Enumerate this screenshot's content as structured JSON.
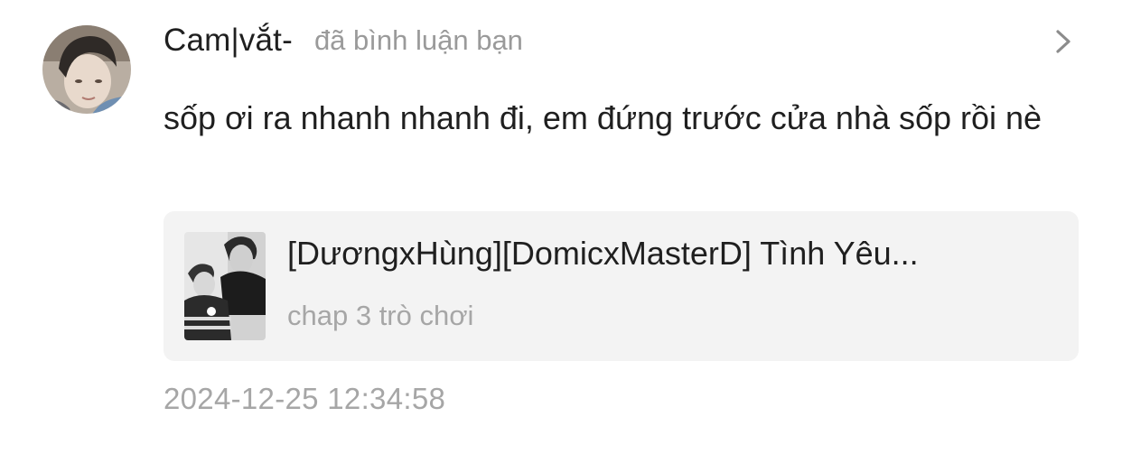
{
  "notification": {
    "username": "Cam|vắt-",
    "action": "đã bình luận bạn",
    "comment": "sốp ơi ra nhanh nhanh đi, em đứng trước cửa nhà sốp rồi nè",
    "timestamp": "2024-12-25 12:34:58",
    "avatar_icon": "user-avatar-photo",
    "chevron_icon": "chevron-right-icon"
  },
  "story": {
    "title": "[DươngxHùng][DomicxMasterD] Tình Yêu...",
    "subtitle": "chap 3 trò chơi",
    "cover_icon": "story-cover-image"
  },
  "colors": {
    "text_primary": "#1f1f1f",
    "text_secondary": "#9a9a9a",
    "card_background": "#f3f3f3",
    "page_background": "#ffffff"
  }
}
